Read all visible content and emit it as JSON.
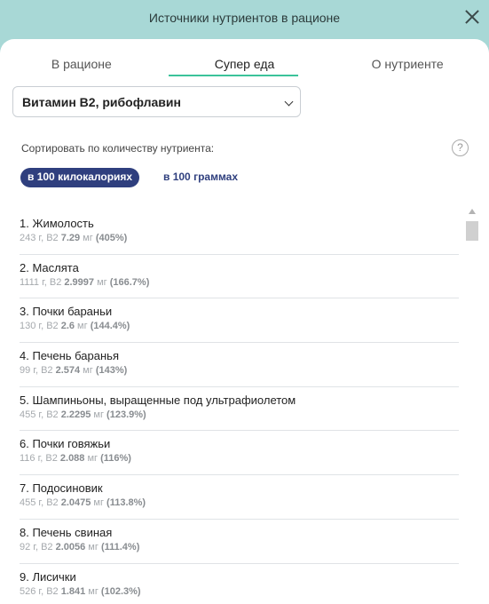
{
  "header": {
    "title": "Источники нутриентов в рационе"
  },
  "tabs": [
    {
      "label": "В рационе"
    },
    {
      "label": "Супер еда"
    },
    {
      "label": "О нутриенте"
    }
  ],
  "nutrient_select": {
    "value": "Витамин B2, рибофлавин"
  },
  "sort": {
    "label": "Сортировать по количеству нутриента:",
    "help": "?",
    "options": [
      "в 100 килокалориях",
      "в 100 граммах"
    ]
  },
  "items": [
    {
      "name": "1. Жимолость",
      "prefix": "243 г, B2 ",
      "amount": "7.29",
      "unit": " мг ",
      "pct": "(405%)"
    },
    {
      "name": "2. Маслята",
      "prefix": "1111 г, B2 ",
      "amount": "2.9997",
      "unit": " мг ",
      "pct": "(166.7%)"
    },
    {
      "name": "3. Почки бараньи",
      "prefix": "130 г, B2 ",
      "amount": "2.6",
      "unit": " мг ",
      "pct": "(144.4%)"
    },
    {
      "name": "4. Печень баранья",
      "prefix": "99 г, B2 ",
      "amount": "2.574",
      "unit": " мг ",
      "pct": "(143%)"
    },
    {
      "name": "5. Шампиньоны, выращенные под ультрафиолетом",
      "prefix": "455 г, B2 ",
      "amount": "2.2295",
      "unit": " мг ",
      "pct": "(123.9%)"
    },
    {
      "name": "6. Почки говяжьи",
      "prefix": "116 г, B2 ",
      "amount": "2.088",
      "unit": " мг ",
      "pct": "(116%)"
    },
    {
      "name": "7. Подосиновик",
      "prefix": "455 г, B2 ",
      "amount": "2.0475",
      "unit": " мг ",
      "pct": "(113.8%)"
    },
    {
      "name": "8. Печень свиная",
      "prefix": "92 г, B2 ",
      "amount": "2.0056",
      "unit": " мг ",
      "pct": "(111.4%)"
    },
    {
      "name": "9. Лисички",
      "prefix": "526 г, B2 ",
      "amount": "1.841",
      "unit": " мг ",
      "pct": "(102.3%)"
    }
  ]
}
